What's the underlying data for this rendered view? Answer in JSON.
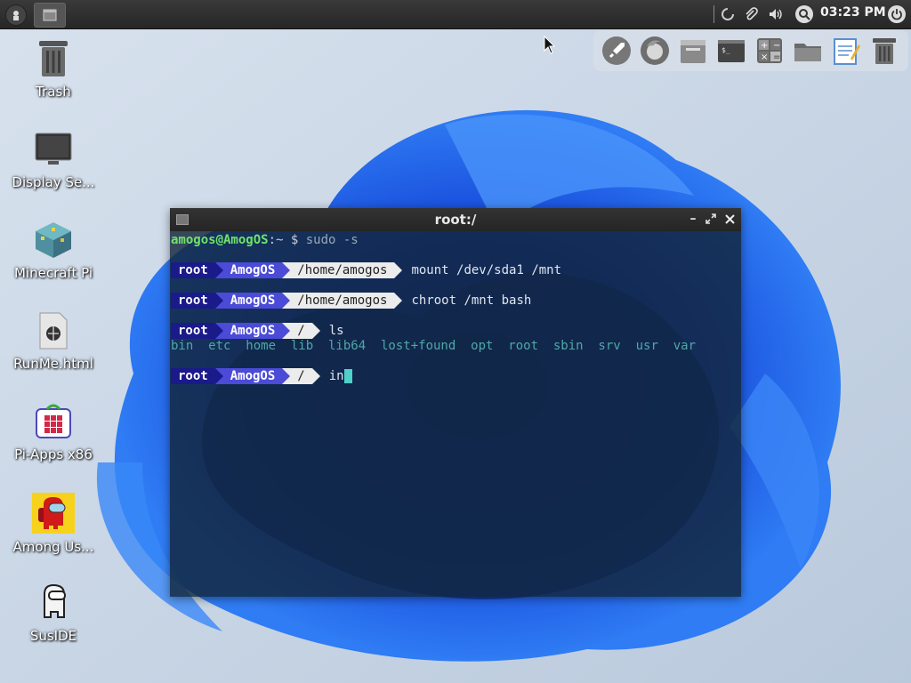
{
  "panel": {
    "clock": "03:23 PM",
    "icons": [
      "app-menu-icon",
      "window-icon",
      "loading-icon",
      "paperclip-icon",
      "volume-icon",
      "search-icon",
      "power-icon"
    ]
  },
  "desktop": {
    "icons": [
      {
        "label": "Trash",
        "icon": "trash-icon"
      },
      {
        "label": "Display Se...",
        "icon": "monitor-icon"
      },
      {
        "label": "Minecraft Pi",
        "icon": "minecraft-block-icon"
      },
      {
        "label": "RunMe.html",
        "icon": "html-file-icon"
      },
      {
        "label": "Pi-Apps x86",
        "icon": "pi-apps-icon"
      },
      {
        "label": "Among Us...",
        "icon": "among-us-icon"
      },
      {
        "label": "SusIDE",
        "icon": "susie-icon"
      }
    ]
  },
  "dock": {
    "items": [
      "rocket-launcher-icon",
      "firefox-icon",
      "file-manager-icon",
      "terminal-icon",
      "calculator-icon",
      "folder-icon",
      "text-editor-icon",
      "trash-icon"
    ]
  },
  "terminal": {
    "title": "root:/",
    "lines": [
      {
        "type": "plain",
        "user": "amogos@AmogOS",
        "sep": ":~ $ ",
        "cmd": "sudo -s"
      },
      {
        "type": "prompt",
        "user": "root",
        "host": "AmogOS",
        "path": "/home/amogos",
        "cmd": "mount /dev/sda1 /mnt"
      },
      {
        "type": "prompt",
        "user": "root",
        "host": "AmogOS",
        "path": "/home/amogos",
        "cmd": "chroot /mnt bash"
      },
      {
        "type": "prompt",
        "user": "root",
        "host": "AmogOS",
        "path": "/",
        "cmd": "ls"
      },
      {
        "type": "output",
        "text": "bin  etc  home  lib  lib64  lost+found  opt  root  sbin  srv  usr  var"
      },
      {
        "type": "prompt",
        "user": "root",
        "host": "AmogOS",
        "path": "/",
        "cmd": "in"
      }
    ]
  }
}
